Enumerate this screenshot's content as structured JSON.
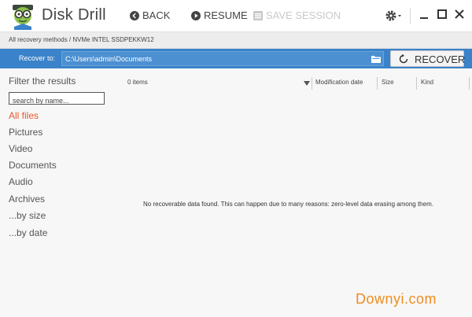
{
  "app": {
    "title": "Disk Drill"
  },
  "toolbar": {
    "back_label": "BACK",
    "resume_label": "RESUME",
    "save_session_label": "SAVE SESSION"
  },
  "breadcrumb": {
    "text": "All recovery methods / NVMe INTEL SSDPEKKW12"
  },
  "recover": {
    "label": "Recover to:",
    "path": "C:\\Users\\admin\\Documents",
    "button_label": "RECOVER"
  },
  "sidebar": {
    "title": "Filter the results",
    "search_placeholder": "search by name...",
    "categories": [
      "All files",
      "Pictures",
      "Video",
      "Documents",
      "Audio",
      "Archives",
      "...by size",
      "...by date"
    ],
    "active_category": "All files"
  },
  "table": {
    "item_count": "0 items",
    "columns": [
      "Modification date",
      "Size",
      "Kind"
    ],
    "empty_message": "No recoverable data found. This can happen due to many reasons: zero-level data erasing among them."
  },
  "watermark": {
    "text": "Downyi.com"
  },
  "colors": {
    "accent_blue": "#3a82c9",
    "active_category": "#e8562c",
    "watermark": "#f08c1e"
  }
}
